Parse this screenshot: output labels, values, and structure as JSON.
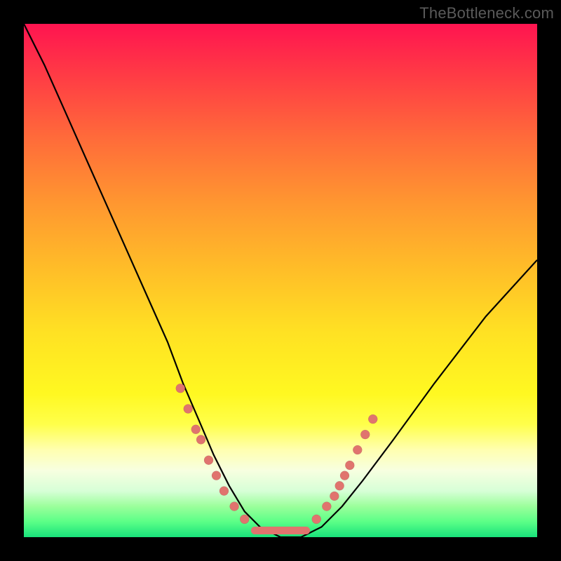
{
  "watermark": "TheBottleneck.com",
  "colors": {
    "curve": "#000000",
    "dot": "#e0746e",
    "background_top": "#ff1450",
    "background_bottom": "#18e27b",
    "frame": "#000000"
  },
  "chart_data": {
    "type": "line",
    "title": "",
    "xlabel": "",
    "ylabel": "",
    "xlim": [
      0,
      100
    ],
    "ylim": [
      0,
      100
    ],
    "grid": false,
    "legend": false,
    "series": [
      {
        "name": "bottleneck-curve",
        "x": [
          0,
          4,
          8,
          12,
          16,
          20,
          24,
          28,
          31,
          34,
          37,
          40,
          43,
          46,
          50,
          54,
          58,
          62,
          66,
          72,
          80,
          90,
          100
        ],
        "y": [
          100,
          92,
          83,
          74,
          65,
          56,
          47,
          38,
          30,
          23,
          16,
          10,
          5,
          2,
          0,
          0,
          2,
          6,
          11,
          19,
          30,
          43,
          54
        ]
      }
    ],
    "markers_left": [
      {
        "x": 30.5,
        "y": 29
      },
      {
        "x": 32.0,
        "y": 25
      },
      {
        "x": 33.5,
        "y": 21
      },
      {
        "x": 34.5,
        "y": 19
      },
      {
        "x": 36.0,
        "y": 15
      },
      {
        "x": 37.5,
        "y": 12
      },
      {
        "x": 39.0,
        "y": 9
      },
      {
        "x": 41.0,
        "y": 6
      },
      {
        "x": 43.0,
        "y": 3.5
      }
    ],
    "markers_right": [
      {
        "x": 57.0,
        "y": 3.5
      },
      {
        "x": 59.0,
        "y": 6
      },
      {
        "x": 60.5,
        "y": 8
      },
      {
        "x": 61.5,
        "y": 10
      },
      {
        "x": 62.5,
        "y": 12
      },
      {
        "x": 63.5,
        "y": 14
      },
      {
        "x": 65.0,
        "y": 17
      },
      {
        "x": 66.5,
        "y": 20
      },
      {
        "x": 68.0,
        "y": 23
      }
    ],
    "flat_segment": {
      "x_start": 45,
      "x_end": 55,
      "y": 1.3
    }
  }
}
